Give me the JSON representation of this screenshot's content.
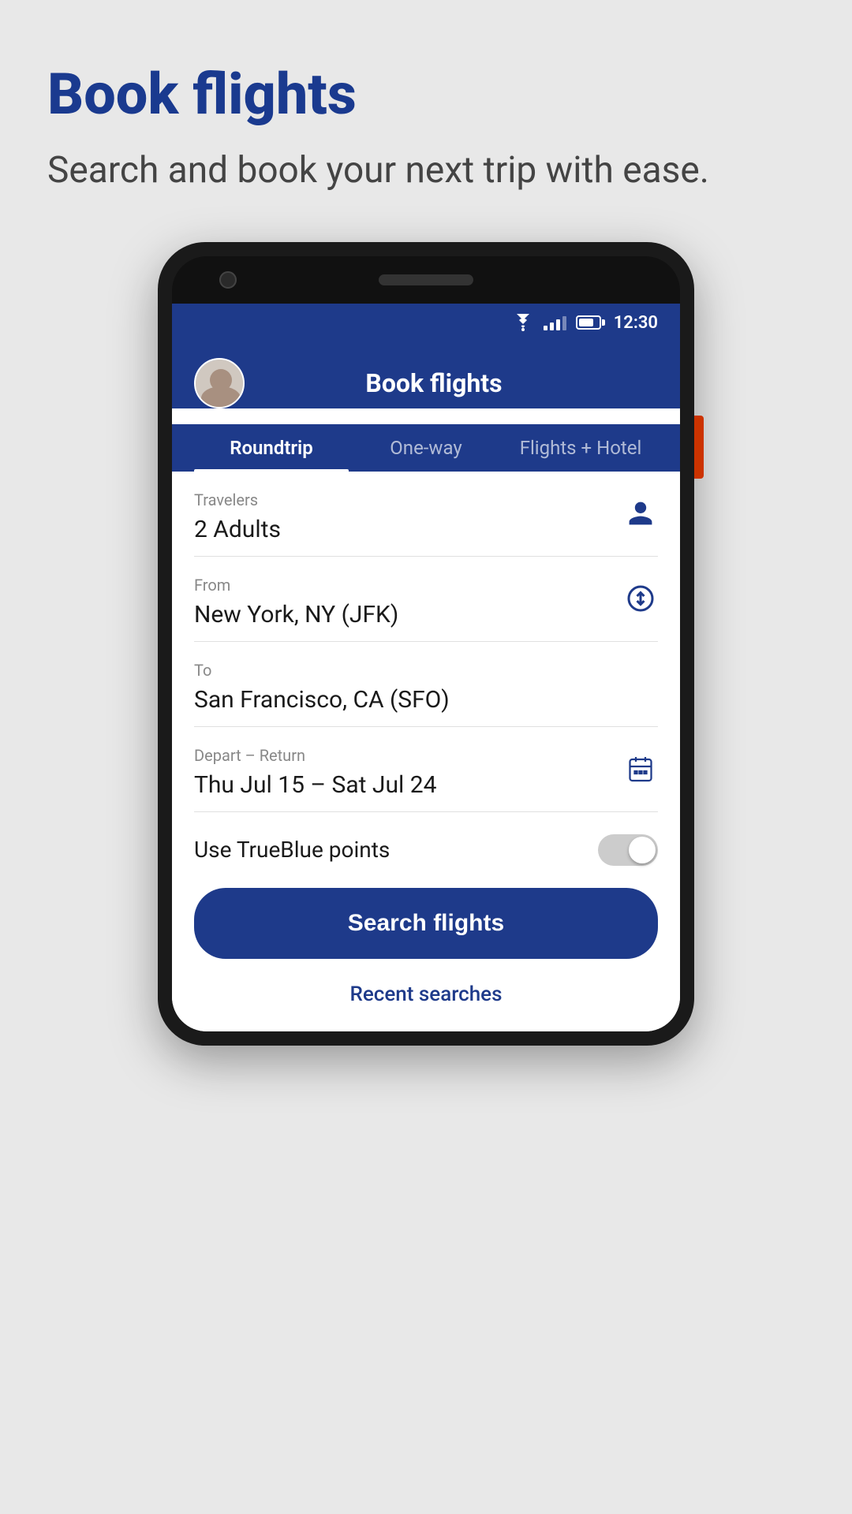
{
  "page": {
    "title": "Book flights",
    "subtitle": "Search and book your next trip with ease.",
    "background_color": "#e8e8e8"
  },
  "status_bar": {
    "time": "12:30"
  },
  "app_header": {
    "title": "Book flights"
  },
  "tabs": [
    {
      "id": "roundtrip",
      "label": "Roundtrip",
      "active": true
    },
    {
      "id": "one-way",
      "label": "One-way",
      "active": false
    },
    {
      "id": "flights-hotel",
      "label": "Flights + Hotel",
      "active": false
    }
  ],
  "form": {
    "travelers": {
      "label": "Travelers",
      "value": "2 Adults"
    },
    "from": {
      "label": "From",
      "value": "New York, NY (JFK)"
    },
    "to": {
      "label": "To",
      "value": "San Francisco, CA (SFO)"
    },
    "dates": {
      "label": "Depart – Return",
      "value": "Thu Jul 15 – Sat Jul 24"
    },
    "trueblue": {
      "label": "Use TrueBlue points",
      "enabled": false
    }
  },
  "buttons": {
    "search": "Search flights",
    "recent": "Recent searches"
  }
}
